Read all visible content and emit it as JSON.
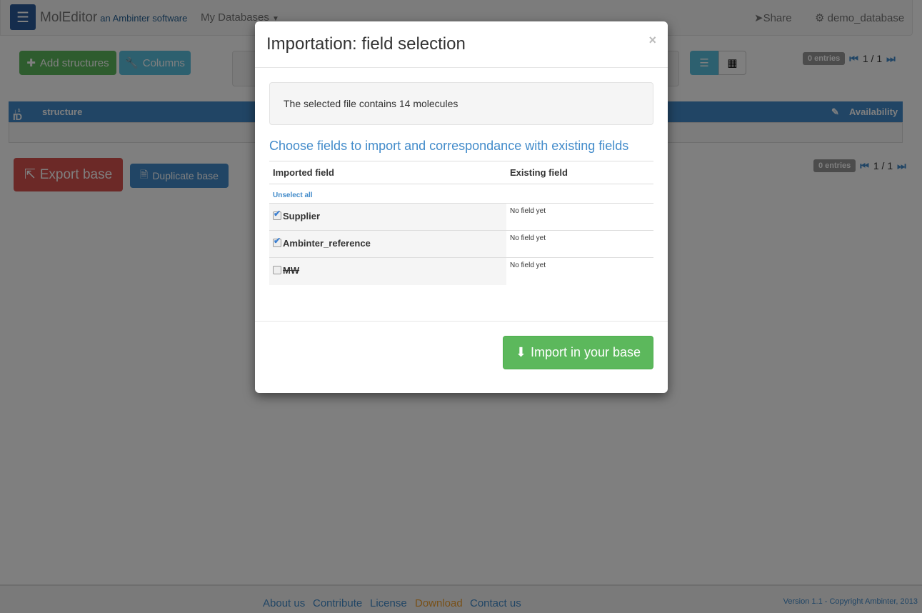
{
  "navbar": {
    "brand": "MolEditor",
    "brand_sub": "an Ambinter software",
    "menu": "My Databases",
    "share": "Share",
    "database": "demo_database"
  },
  "toolbar": {
    "add": "Add structures",
    "columns": "Columns"
  },
  "pagination": {
    "entries": "0 entries",
    "page": "1 / 1"
  },
  "table": {
    "headers": [
      "ID",
      "structure",
      "Availability"
    ]
  },
  "actions": {
    "export": "Export base",
    "duplicate": "Duplicate base"
  },
  "footer": {
    "links": [
      "About us",
      "Contribute",
      "License",
      "Download",
      "Contact us"
    ],
    "version": "Version 1.1 - Copyright Ambinter, 2013"
  },
  "modal": {
    "title": "Importation: field selection",
    "close": "×",
    "info": "The selected file contains 14 molecules",
    "subtitle": "Choose fields to import and correspondance with existing fields",
    "col_imported": "Imported field",
    "col_existing": "Existing field",
    "unselect": "Unselect all",
    "fields": [
      {
        "name": "Supplier",
        "checked": true,
        "existing": "No field yet"
      },
      {
        "name": "Ambinter_reference",
        "checked": true,
        "existing": "No field yet"
      },
      {
        "name": "MW",
        "checked": false,
        "existing": "No field yet"
      }
    ],
    "import_button": "Import in your base"
  }
}
